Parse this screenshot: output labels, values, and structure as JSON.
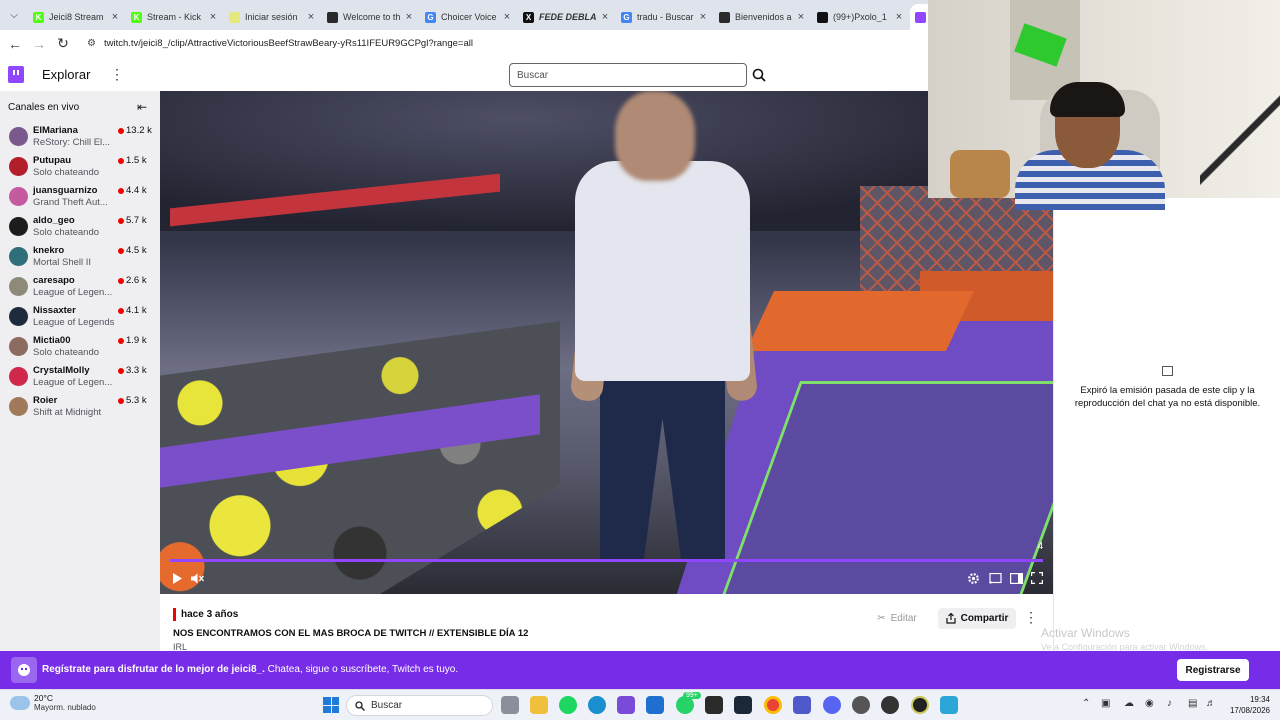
{
  "browser": {
    "tabs": [
      {
        "title": "Jeici8 Stream",
        "favicon_color": "#53fc18",
        "favicon": "K",
        "active": false
      },
      {
        "title": "Stream - Kick",
        "favicon_color": "#53fc18",
        "favicon": "K",
        "active": false
      },
      {
        "title": "Iniciar sesión",
        "favicon_color": "#e5e87a",
        "favicon": "",
        "active": false
      },
      {
        "title": "Welcome to th",
        "favicon_color": "#2a2a2a",
        "favicon": "",
        "active": false
      },
      {
        "title": "Choicer Voice",
        "favicon_color": "#4285f4",
        "favicon": "G",
        "active": false
      },
      {
        "title": "FEDE DEBLA",
        "favicon_color": "#111111",
        "favicon": "X",
        "active": false
      },
      {
        "title": "tradu - Buscar",
        "favicon_color": "#4285f4",
        "favicon": "G",
        "active": false
      },
      {
        "title": "Bienvenidos a",
        "favicon_color": "#2a2a2a",
        "favicon": "",
        "active": false
      },
      {
        "title": "(99+)Pxolo_1",
        "favicon_color": "#111111",
        "favicon": "",
        "active": false
      },
      {
        "title": "",
        "favicon_color": "#9146ff",
        "favicon": "",
        "active": true
      }
    ],
    "url": "twitch.tv/jeici8_/clip/AttractiveVictoriousBeefStrawBeary-yRs11IFEUR9GCPgl?range=all"
  },
  "twitch": {
    "nav": {
      "explore": "Explorar",
      "search_placeholder": "Buscar"
    },
    "sidebar": {
      "header": "Canales en vivo",
      "channels": [
        {
          "name": "ElMariana",
          "game": "ReStory: Chill El...",
          "viewers": "13.2 k",
          "avatar_color": "#7a5a8c"
        },
        {
          "name": "Putupau",
          "game": "Solo chateando",
          "viewers": "1.5 k",
          "avatar_color": "#b21e2a"
        },
        {
          "name": "juansguarnizo",
          "game": "Grand Theft Aut...",
          "viewers": "4.4 k",
          "avatar_color": "#c65aa0"
        },
        {
          "name": "aldo_geo",
          "game": "Solo chateando",
          "viewers": "5.7 k",
          "avatar_color": "#1c1c1c"
        },
        {
          "name": "knekro",
          "game": "Mortal Shell II",
          "viewers": "4.5 k",
          "avatar_color": "#2f6f7a"
        },
        {
          "name": "caresapo",
          "game": "League of Legen...",
          "viewers": "2.6 k",
          "avatar_color": "#8d8a7a"
        },
        {
          "name": "Nissaxter",
          "game": "League of Legends",
          "viewers": "4.1 k",
          "avatar_color": "#1e2b3a"
        },
        {
          "name": "Mictia00",
          "game": "Solo chateando",
          "viewers": "1.9 k",
          "avatar_color": "#8c6b60"
        },
        {
          "name": "CrystalMolly",
          "game": "League of Legen...",
          "viewers": "3.3 k",
          "avatar_color": "#d0284a"
        },
        {
          "name": "Roier",
          "game": "Shift at Midnight",
          "viewers": "5.3 k",
          "avatar_color": "#a07a5a"
        }
      ]
    },
    "video": {
      "counter": "4",
      "progress": 1.0
    },
    "clip": {
      "ago": "hace 3 años",
      "title": "NOS ENCONTRAMOS CON EL MAS BROCA DE TWITCH // EXTENSIBLE DÍA 12",
      "category": "IRL",
      "edit_label": "Editar",
      "share_label": "Compartir"
    },
    "chat_unavailable": "Expiró la emisión pasada de este clip y la reproducción del chat ya no está disponible.",
    "register_bar": {
      "text_bold": "Regístrate para disfrutar de lo mejor de jeici8_.",
      "text": " Chatea, sigue o suscríbete, Twitch es tuyo.",
      "button": "Registrarse"
    }
  },
  "windows": {
    "watermark_title": "Activar Windows",
    "watermark_sub": "Ve a Configuración para activar Windows.",
    "weather_temp": "20°C",
    "weather_desc": "Mayorm. nublado",
    "search_label": "Buscar",
    "time": "19:34",
    "date": "17/08/2026",
    "badges": {
      "whatsapp": "99+"
    }
  }
}
